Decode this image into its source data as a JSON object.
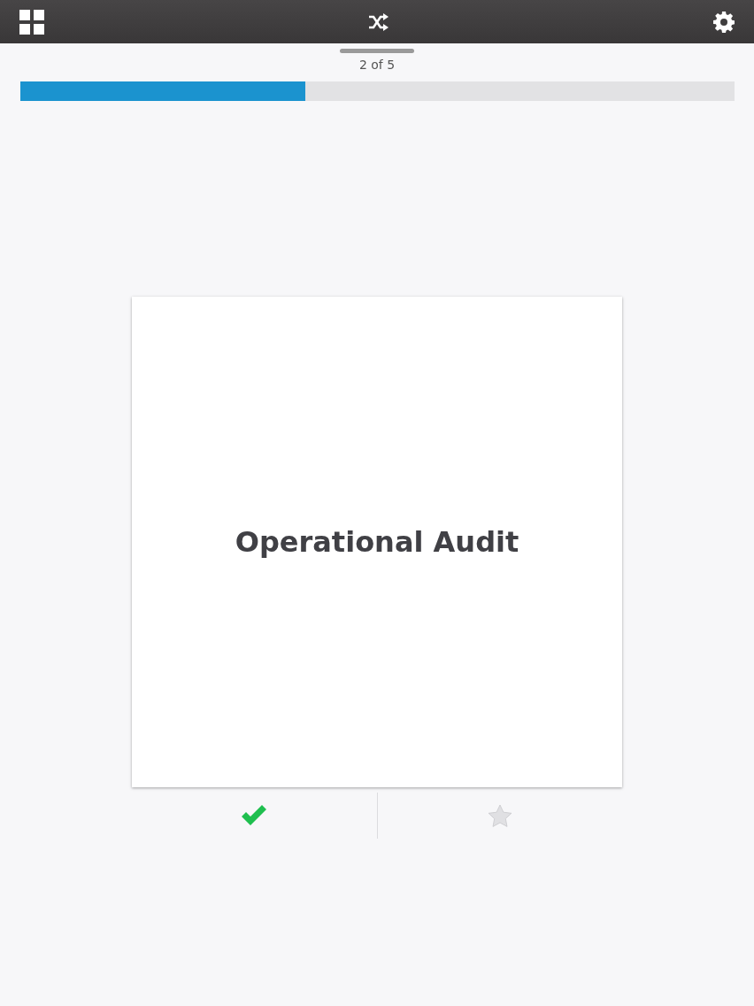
{
  "counter": "2 of 5",
  "progress": {
    "level": 0.4
  },
  "card": {
    "term": "Operational Audit"
  },
  "actions": {
    "known": true,
    "starred": false
  }
}
